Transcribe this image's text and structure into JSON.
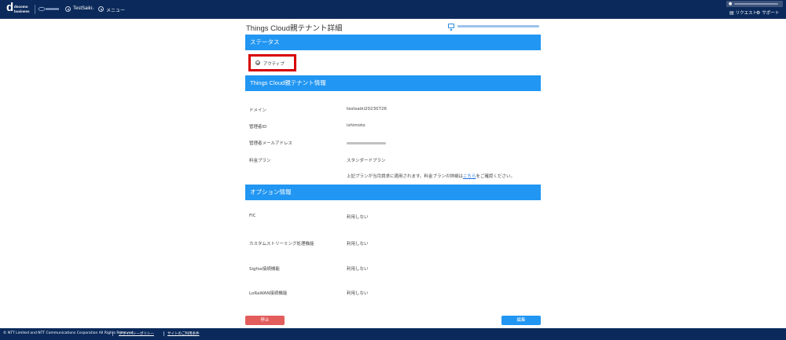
{
  "topbar": {
    "logo": {
      "mark": "d",
      "line1": "docomo",
      "line2": "business"
    },
    "breadcrumb": {
      "tenant": "TestSaiki",
      "menu": "メニュー"
    },
    "links": {
      "request": "リクエスト",
      "support": "サポート"
    }
  },
  "header": {
    "title": "Things Cloud親テナント詳細"
  },
  "status_section": {
    "title": "ステータス",
    "status": "アクティブ"
  },
  "tenant_section": {
    "title": "Things Cloud親テナント情報",
    "rows": [
      {
        "label": "ドメイン",
        "value": "testsaiki20230726"
      },
      {
        "label": "管理者ID",
        "value": "ishimoto"
      },
      {
        "label": "管理者メールアドレス",
        "value": ""
      },
      {
        "label": "料金プラン",
        "value": "スタンダードプラン"
      }
    ],
    "plan_note": {
      "before": "上記プランが当月請求に適用されます。料金プランの詳細は",
      "link": "こちら",
      "after": "をご確認ください。"
    }
  },
  "option_section": {
    "title": "オプション情報",
    "rows": [
      {
        "label": "FIC",
        "value": "利用しない"
      },
      {
        "label": "カスタムストリーミング処理機能",
        "value": "利用しない"
      },
      {
        "label": "Sigfox接続機能",
        "value": "利用しない"
      },
      {
        "label": "LoRaWAN接続機能",
        "value": "利用しない"
      }
    ]
  },
  "buttons": {
    "stop": "停止",
    "edit": "編集"
  },
  "footer": {
    "copyright": "© NTT Limited and NTT Communications Corporation All Rights Reserved.",
    "privacy": "プライバシーポリシー",
    "terms": "サイトのご利用条件"
  },
  "colors": {
    "topbar": "#0b2a5b",
    "section": "#2196f3",
    "stop": "#e35d5d",
    "highlight": "#d60000"
  }
}
